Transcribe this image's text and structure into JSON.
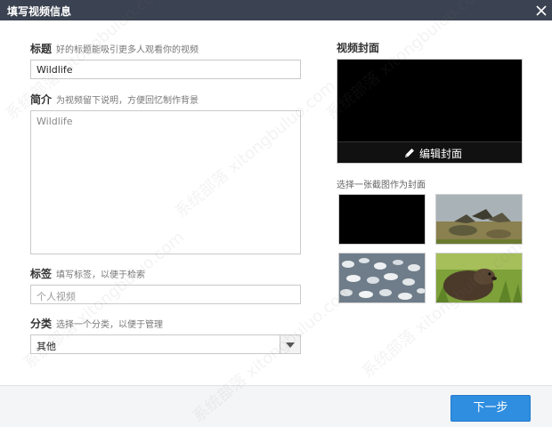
{
  "window": {
    "title": "填写视频信息"
  },
  "title_field": {
    "label": "标题",
    "hint": "好的标题能吸引更多人观看你的视频",
    "value": "Wildlife"
  },
  "description_field": {
    "label": "简介",
    "hint": "为视频留下说明，方便回忆制作背景",
    "value": "Wildlife"
  },
  "tags_field": {
    "label": "标签",
    "hint": "填写标签，以便于检索",
    "placeholder": "个人视频"
  },
  "category_field": {
    "label": "分类",
    "hint": "选择一个分类，以便于管理",
    "selected": "其他"
  },
  "cover": {
    "title": "视频封面",
    "edit_label": "编辑封面",
    "hint": "选择一张截图作为封面"
  },
  "footer": {
    "next_label": "下一步"
  },
  "watermark": "系统部落 xitongbuluo.com",
  "colors": {
    "titlebar": "#3b4251",
    "accent": "#2f8ee0"
  }
}
